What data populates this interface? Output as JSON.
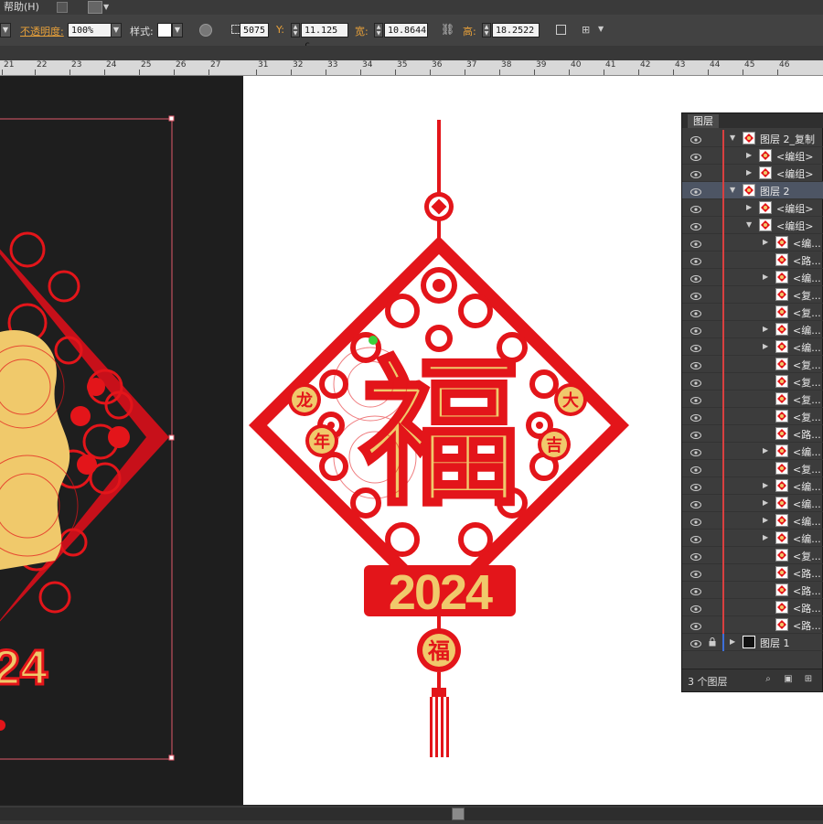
{
  "menubar": {
    "help_label": "帮助(H)"
  },
  "control_bar": {
    "opacity_label": "不透明度:",
    "opacity_value": "100%",
    "style_label": "样式:",
    "x_value": "5075",
    "y_label": "Y:",
    "y_value": "11.125 c",
    "width_label": "宽:",
    "width_value": "10.8644",
    "height_label": "高:",
    "height_value": "18.2522"
  },
  "ruler": {
    "ticks": [
      "21",
      "22",
      "23",
      "24",
      "25",
      "26",
      "27",
      "31",
      "32",
      "33",
      "34",
      "35",
      "36",
      "37",
      "38",
      "39",
      "40",
      "41",
      "42",
      "43",
      "44",
      "45",
      "46"
    ]
  },
  "artwork": {
    "main_char": "福",
    "year": "2024",
    "left_chars": [
      "龙",
      "年"
    ],
    "right_chars": [
      "大",
      "吉"
    ],
    "small_char": "福",
    "red": "#e3151a",
    "gold": "#f0c96b"
  },
  "layers_panel": {
    "tab_label": "图层",
    "layers": [
      {
        "name": "图层 2_复制",
        "level": 0,
        "expanded": true
      },
      {
        "name": "<编组>",
        "level": 1,
        "expanded": false
      },
      {
        "name": "<编组>",
        "level": 1,
        "expanded": false
      },
      {
        "name": "图层 2",
        "level": 0,
        "expanded": true,
        "selected": true
      },
      {
        "name": "<编组>",
        "level": 1,
        "expanded": false
      },
      {
        "name": "<编组>",
        "level": 1,
        "expanded": true
      },
      {
        "name": "<编...",
        "level": 2,
        "expanded": false
      },
      {
        "name": "<路...",
        "level": 2
      },
      {
        "name": "<编...",
        "level": 2,
        "expanded": false
      },
      {
        "name": "<复...",
        "level": 2
      },
      {
        "name": "<复...",
        "level": 2
      },
      {
        "name": "<编...",
        "level": 2,
        "expanded": false
      },
      {
        "name": "<编...",
        "level": 2,
        "expanded": false
      },
      {
        "name": "<复...",
        "level": 2
      },
      {
        "name": "<复...",
        "level": 2
      },
      {
        "name": "<复...",
        "level": 2
      },
      {
        "name": "<复...",
        "level": 2
      },
      {
        "name": "<路...",
        "level": 2
      },
      {
        "name": "<编...",
        "level": 2,
        "expanded": false
      },
      {
        "name": "<复...",
        "level": 2
      },
      {
        "name": "<编...",
        "level": 2,
        "expanded": false
      },
      {
        "name": "<编...",
        "level": 2,
        "expanded": false
      },
      {
        "name": "<编...",
        "level": 2,
        "expanded": false
      },
      {
        "name": "<编...",
        "level": 2,
        "expanded": false
      },
      {
        "name": "<复...",
        "level": 2
      },
      {
        "name": "<路...",
        "level": 2
      },
      {
        "name": "<路...",
        "level": 2
      },
      {
        "name": "<路...",
        "level": 2
      },
      {
        "name": "<路...",
        "level": 2
      },
      {
        "name": "图层 1",
        "level": 0,
        "expanded": false,
        "locked": true
      }
    ],
    "footer_count": "3 个图层"
  }
}
